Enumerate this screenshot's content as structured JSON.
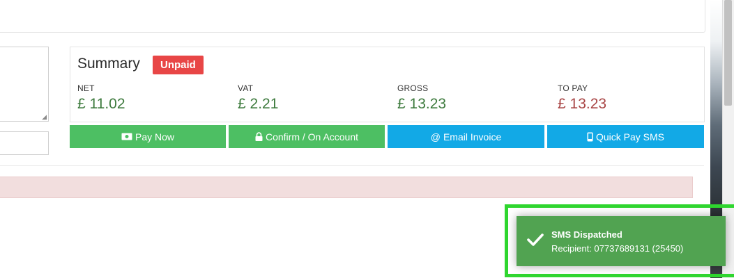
{
  "summary": {
    "title": "Summary",
    "status_badge": "Unpaid",
    "stats": [
      {
        "label": "NET",
        "value": "£ 11.02"
      },
      {
        "label": "VAT",
        "value": "£ 2.21"
      },
      {
        "label": "GROSS",
        "value": "£ 13.23"
      },
      {
        "label": "TO PAY",
        "value": "£ 13.23"
      }
    ]
  },
  "actions": {
    "pay_now": {
      "label": "Pay Now",
      "icon": "cash-icon"
    },
    "confirm": {
      "label": "Confirm / On Account",
      "icon": "lock-icon"
    },
    "email": {
      "label": "Email Invoice",
      "icon": "at-icon"
    },
    "sms": {
      "label": "Quick Pay SMS",
      "icon": "mobile-icon"
    }
  },
  "toast": {
    "title": "SMS Dispatched",
    "message": "Recipient: 07737689131 (25450)",
    "icon": "checkmark-icon"
  },
  "colors": {
    "green": "#4dbf63",
    "blue": "#12a9e6",
    "badge_red": "#e84646",
    "toast_green": "#51a351",
    "highlight": "#2fd62f",
    "value_green": "#3d7a3d",
    "value_red": "#a84444"
  }
}
